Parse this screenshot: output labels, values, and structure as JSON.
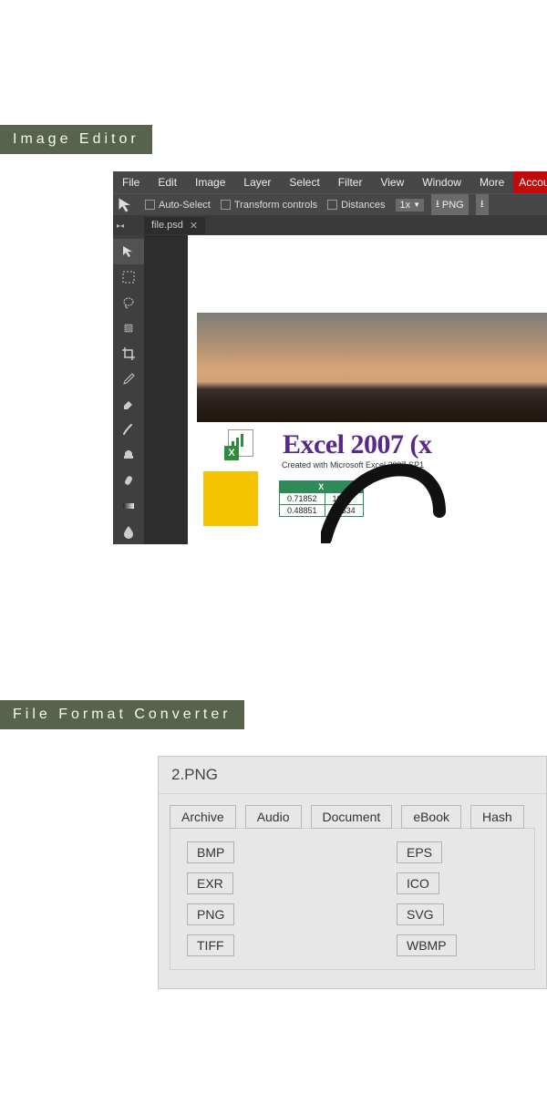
{
  "sections": {
    "editor_label": "Image Editor",
    "converter_label": "File Format Converter"
  },
  "editor": {
    "menu": [
      "File",
      "Edit",
      "Image",
      "Layer",
      "Select",
      "Filter",
      "View",
      "Window",
      "More"
    ],
    "account": "Account",
    "options": {
      "auto_select": "Auto-Select",
      "transform_controls": "Transform controls",
      "distances": "Distances",
      "zoom": "1x",
      "export_format": "PNG"
    },
    "tab": {
      "filename": "file.psd"
    },
    "canvas": {
      "excel_title": "Excel 2007 (x",
      "excel_subtitle": "Created with Microsoft Excel 2007 SP1",
      "table": {
        "col_header": "X",
        "rows": [
          [
            "0.71852",
            "1683"
          ],
          [
            "0.48851",
            "67534"
          ]
        ]
      }
    }
  },
  "converter": {
    "header": "2.PNG",
    "category_tabs": [
      "Archive",
      "Audio",
      "Document",
      "eBook",
      "Hash"
    ],
    "formats_col1": [
      "BMP",
      "EXR",
      "PNG",
      "TIFF"
    ],
    "formats_col2": [
      "EPS",
      "ICO",
      "SVG",
      "WBMP"
    ]
  }
}
